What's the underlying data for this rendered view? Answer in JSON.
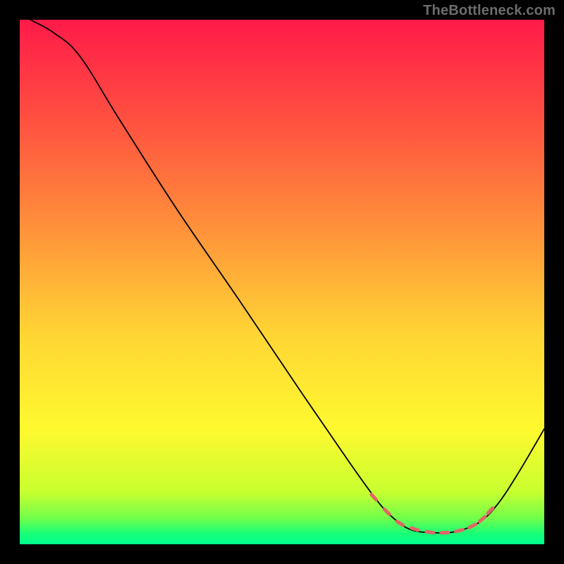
{
  "watermark": "TheBottleneck.com",
  "chart_data": {
    "type": "line",
    "title": "",
    "subtitle": "",
    "xlabel": "",
    "ylabel": "",
    "xlim": [
      0,
      100
    ],
    "ylim": [
      0,
      100
    ],
    "grid": false,
    "legend": false,
    "annotations": [],
    "background_gradient": {
      "type": "vertical",
      "stops": [
        {
          "pos": 0.0,
          "color": "#ff1a49"
        },
        {
          "pos": 0.2,
          "color": "#ff5340"
        },
        {
          "pos": 0.4,
          "color": "#ff923a"
        },
        {
          "pos": 0.6,
          "color": "#ffd534"
        },
        {
          "pos": 0.78,
          "color": "#fff92f"
        },
        {
          "pos": 0.9,
          "color": "#c8ff2f"
        },
        {
          "pos": 0.95,
          "color": "#72ff4a"
        },
        {
          "pos": 0.98,
          "color": "#18ff78"
        },
        {
          "pos": 1.0,
          "color": "#00ff8e"
        }
      ]
    },
    "series": [
      {
        "name": "bottleneck-curve",
        "color": "#000000",
        "width": 1.8,
        "points": [
          {
            "x": 2.0,
            "y": 100.0
          },
          {
            "x": 6.5,
            "y": 97.5
          },
          {
            "x": 11.5,
            "y": 93.0
          },
          {
            "x": 19.0,
            "y": 81.0
          },
          {
            "x": 30.0,
            "y": 63.8
          },
          {
            "x": 42.0,
            "y": 46.3
          },
          {
            "x": 54.0,
            "y": 28.5
          },
          {
            "x": 63.0,
            "y": 15.4
          },
          {
            "x": 68.0,
            "y": 8.5
          },
          {
            "x": 71.0,
            "y": 5.2
          },
          {
            "x": 74.5,
            "y": 2.8
          },
          {
            "x": 79.0,
            "y": 2.2
          },
          {
            "x": 83.0,
            "y": 2.4
          },
          {
            "x": 87.5,
            "y": 4.1
          },
          {
            "x": 91.0,
            "y": 7.5
          },
          {
            "x": 95.0,
            "y": 13.5
          },
          {
            "x": 100.0,
            "y": 22.0
          }
        ]
      },
      {
        "name": "marker-dashes",
        "color": "#e06666",
        "stroke_width": 5,
        "dash": [
          10,
          6
        ],
        "points": [
          {
            "x": 67.5,
            "y": 9.0
          },
          {
            "x": 70.0,
            "y": 6.2
          },
          {
            "x": 72.5,
            "y": 4.0
          },
          {
            "x": 75.3,
            "y": 2.9
          },
          {
            "x": 78.2,
            "y": 2.3
          },
          {
            "x": 81.0,
            "y": 2.2
          },
          {
            "x": 83.8,
            "y": 2.6
          },
          {
            "x": 86.3,
            "y": 3.5
          },
          {
            "x": 88.2,
            "y": 4.8
          },
          {
            "x": 89.7,
            "y": 6.4
          }
        ]
      }
    ]
  }
}
